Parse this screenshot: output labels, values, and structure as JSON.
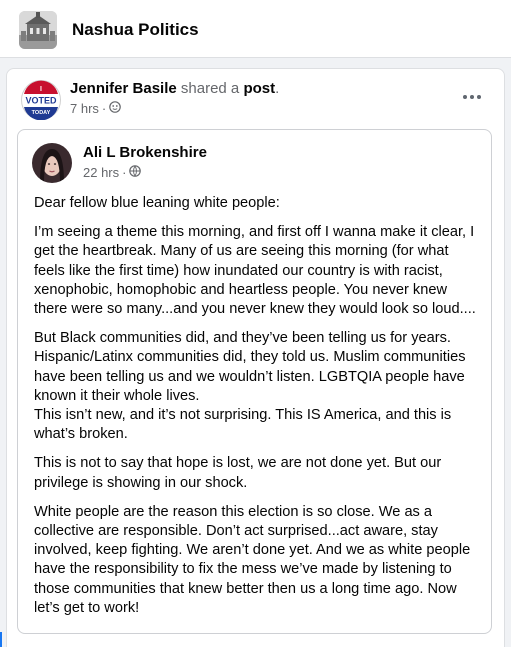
{
  "group": {
    "name": "Nashua Politics",
    "thumbnail_icon": "building-photo"
  },
  "post": {
    "sharer_name": "Jennifer Basile",
    "shared_text": " shared a ",
    "post_word": "post",
    "period": ".",
    "time": "7 hrs",
    "separator": "·",
    "audience_icon": "public-globe-icon",
    "avatar_badge": {
      "top": "I",
      "middle": "VOTED",
      "bottom": "TODAY"
    }
  },
  "shared_post": {
    "author_name": "Ali L Brokenshire",
    "time": "22 hrs",
    "separator": "·",
    "audience_icon": "public-globe-icon",
    "paragraphs": [
      "Dear fellow blue leaning white people:",
      "I’m seeing a theme this morning, and first off I wanna make it clear, I get the heartbreak. Many of us are seeing this morning (for what feels like the first time) how inundated our country is with racist, xenophobic, homophobic and heartless people. You never knew there were so many...and you never knew they would look so loud....",
      "But Black communities did, and they’ve been telling us for years. Hispanic/Latinx communities did, they told us. Muslim communities have been telling us and we wouldn’t listen. LGBTQIA people have known it their whole lives.\nThis isn’t new, and it’s not surprising. This IS America, and this is what’s broken.",
      "This is not to say that hope is lost, we are not done yet. But our privilege is showing in our shock.",
      "White people are the reason this election is so close. We as a collective are responsible. Don’t act surprised...act aware, stay involved, keep fighting. We aren’t done yet. And we as white people have the responsibility to fix the mess we’ve made by listening to those communities that knew better then us a long time ago. Now let’s get to work!"
    ]
  },
  "colors": {
    "accent": "#1877f2",
    "muted": "#65676b",
    "voted_red": "#c8102e",
    "voted_blue": "#1f3a93"
  }
}
